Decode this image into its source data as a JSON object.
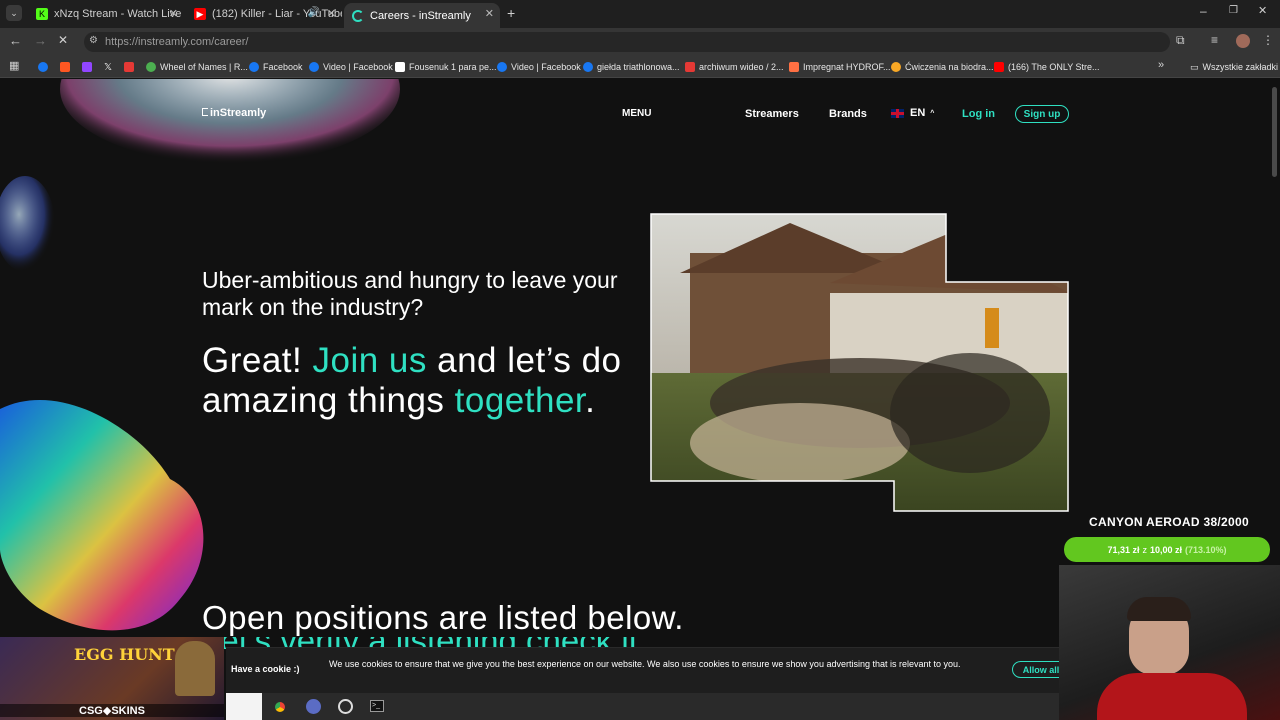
{
  "tabs": [
    {
      "title": "xNzq Stream - Watch Live on K",
      "icon_color": "#53fc18"
    },
    {
      "title": "(182) Killer - Liar - YouTube",
      "icon_color": "#ff0000"
    },
    {
      "title": "Careers - inStreamly",
      "icon_color": "#2fe0c2"
    }
  ],
  "toolbar": {
    "url": "https://instreamly.com/career/"
  },
  "bookmarks": [
    {
      "label": "",
      "color": "#1877f2"
    },
    {
      "label": "",
      "color": "#ff5722"
    },
    {
      "label": "",
      "color": "#9146ff"
    },
    {
      "label": "",
      "color": "#ffffff"
    },
    {
      "label": "",
      "color": "#e53935"
    },
    {
      "label": "Wheel of Names | R...",
      "color": "#4caf50"
    },
    {
      "label": "Facebook",
      "color": "#1877f2"
    },
    {
      "label": "Video | Facebook",
      "color": "#1877f2"
    },
    {
      "label": "Fousenuk 1 para pe...",
      "color": "#ffffff"
    },
    {
      "label": "Video | Facebook",
      "color": "#1877f2"
    },
    {
      "label": "giełda triathlonowa...",
      "color": "#1877f2"
    },
    {
      "label": "archiwum wideo / 2...",
      "color": "#e53935"
    },
    {
      "label": "Impregnat HYDROF...",
      "color": "#ff7043"
    },
    {
      "label": "Ćwiczenia na biodra...",
      "color": "#f9a825"
    },
    {
      "label": "(166) The ONLY Stre...",
      "color": "#ff0000"
    }
  ],
  "bookmarks_more": "Wszystkie zakładki",
  "site": {
    "logo": "inStreamly",
    "menu": "MENU",
    "nav": {
      "streamers": "Streamers",
      "brands": "Brands",
      "lang": "EN",
      "login": "Log in",
      "signup": "Sign up"
    },
    "intro": "Uber-ambitious and hungry to leave your mark on the industry?",
    "headline": {
      "part1": "Great! ",
      "accent1": "Join us",
      "part2": " and let’s do amazing things ",
      "accent2": "together",
      "part3": "."
    },
    "positions": "Open positions are listed below.",
    "positions_second": "Let’s verify a listening check it"
  },
  "cookie": {
    "title": "Have a cookie :)",
    "text": "We use cookies to ensure that we give you the best experience on our website. We also use cookies to ensure we show you advertising that is relevant to you.",
    "button": "Allow all"
  },
  "promo": {
    "title": "CANYON AEROAD 38/2000",
    "amount": "71,31 zł",
    "target": "10,00 zł",
    "percent": "(713.10%)",
    "progress": 1.0,
    "bar_color": "#62c71f"
  },
  "game_ad": {
    "title": "EGG HUNT",
    "brand": "CSG◆SKINS"
  }
}
